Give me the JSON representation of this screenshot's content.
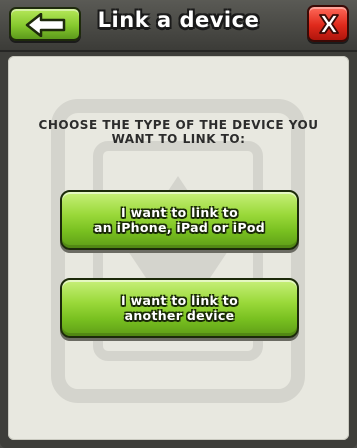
{
  "header": {
    "title": "Link a device",
    "back_icon": "arrow-left-icon",
    "close_icon": "close-x-icon"
  },
  "body": {
    "prompt_line1": "Choose the type of the device you",
    "prompt_line2": "want to link to:"
  },
  "options": [
    {
      "line1": "I want to link to",
      "line2": "an iPhone, iPad or iPod"
    },
    {
      "line1": "I want to link to",
      "line2": "another device"
    }
  ],
  "colors": {
    "green_button": "#86c92e",
    "red_button": "#e02a1c",
    "panel": "#e8e8e0",
    "frame": "#3e3e3a"
  }
}
